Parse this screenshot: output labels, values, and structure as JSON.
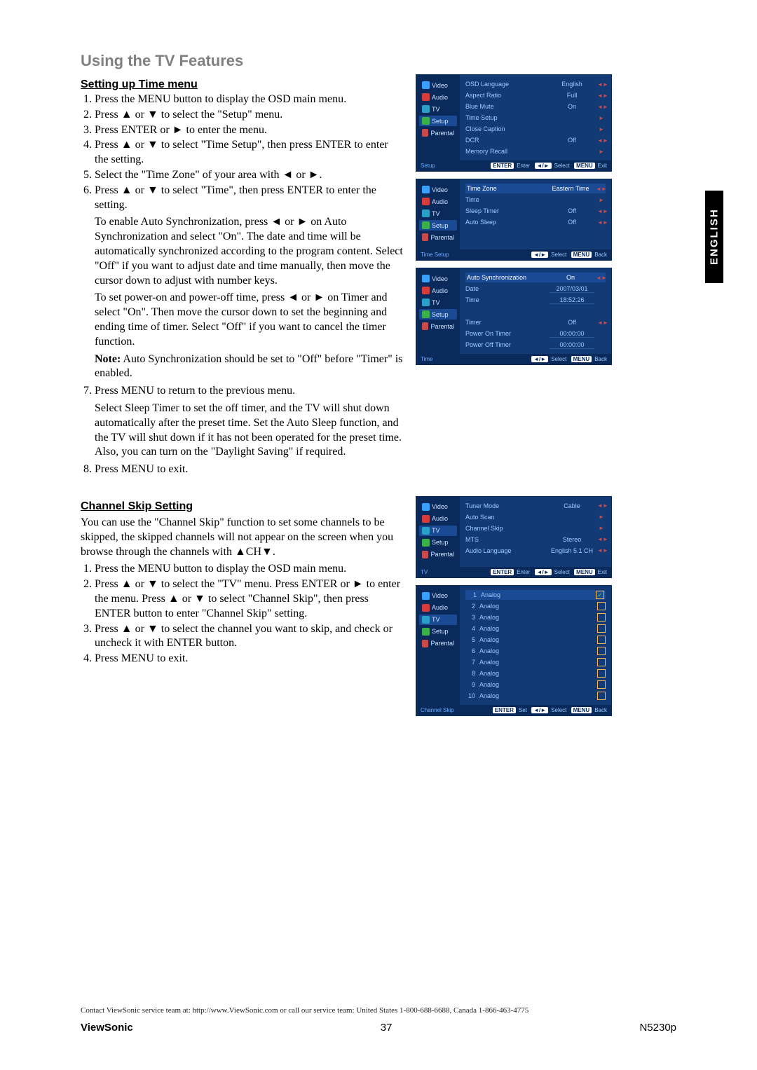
{
  "title": "Using the TV Features",
  "language_tab": "ENGLISH",
  "time_menu": {
    "heading": "Setting up Time menu",
    "steps": [
      "Press the MENU button to display the OSD main menu.",
      "Press ▲ or ▼ to select the \"Setup\" menu.",
      "Press ENTER or ► to enter the menu.",
      "Press ▲ or ▼ to select \"Time Setup\", then press ENTER to enter the setting.",
      "Select the \"Time Zone\" of your area with ◄ or ►.",
      "Press ▲ or ▼ to select \"Time\", then press ENTER to enter the setting.",
      "Press MENU to return to the previous menu.",
      "Press MENU to exit."
    ],
    "para1": "To enable Auto Synchronization, press ◄ or ► on Auto Synchronization and select \"On\". The date and time will be automatically synchronized according to the program content. Select \"Off\" if you want to adjust date and time manually, then move the cursor down to adjust with number keys.",
    "para2": "To set power-on and power-off time, press ◄ or ► on Timer and select \"On\". Then move the cursor down to set the beginning and ending time of timer. Select \"Off\" if you want to cancel the timer function.",
    "note": "Note: Auto Synchronization should be set to \"Off\" before \"Timer\" is enabled.",
    "para3": "Select Sleep Timer to set the off timer, and the TV will shut down automatically after the preset time. Set the Auto Sleep function, and the TV will shut down if it has not been operated for the preset time. Also, you can turn on the \"Daylight Saving\" if required."
  },
  "channel_skip": {
    "heading": "Channel Skip Setting",
    "intro": "You can use the \"Channel Skip\" function to set some channels to be skipped, the skipped channels will not appear on the screen when you browse through the channels with ▲CH▼.",
    "steps": [
      "Press the MENU button to display the OSD main menu.",
      "Press ▲ or ▼ to select the \"TV\" menu. Press ENTER or ► to enter the menu. Press ▲ or ▼ to select \"Channel Skip\", then press ENTER button to enter \"Channel Skip\" setting.",
      "Press ▲ or ▼ to select the channel you want to skip, and check or uncheck it with ENTER button.",
      "Press MENU to exit."
    ]
  },
  "osd_sidebar": [
    "Video",
    "Audio",
    "TV",
    "Setup",
    "Parental"
  ],
  "osd_hints": {
    "enter_label": "ENTER",
    "enter_hint": "Enter",
    "set_hint": "Set",
    "arrows": "◄/►",
    "select_hint": "Select",
    "menu_label": "MENU",
    "exit_hint": "Exit",
    "back_hint": "Back"
  },
  "osd1": {
    "title": "Setup",
    "active": "Setup",
    "rows": [
      {
        "lbl": "OSD Language",
        "val": "English",
        "ind": "◄►"
      },
      {
        "lbl": "Aspect Ratio",
        "val": "Full",
        "ind": "◄►"
      },
      {
        "lbl": "Blue Mute",
        "val": "On",
        "ind": "◄►"
      },
      {
        "lbl": "Time Setup",
        "val": "",
        "ind": "►"
      },
      {
        "lbl": "Close Caption",
        "val": "",
        "ind": "►"
      },
      {
        "lbl": "DCR",
        "val": "Off",
        "ind": "◄►"
      },
      {
        "lbl": "Memory Recall",
        "val": "",
        "ind": "►"
      }
    ]
  },
  "osd2": {
    "title": "Time Setup",
    "active": "Setup",
    "rows": [
      {
        "lbl": "Time Zone",
        "val": "Eastern Time",
        "ind": "◄►",
        "hl": true
      },
      {
        "lbl": "Time",
        "val": "",
        "ind": "►"
      },
      {
        "lbl": "Sleep Timer",
        "val": "Off",
        "ind": "◄►"
      },
      {
        "lbl": "Auto Sleep",
        "val": "Off",
        "ind": "◄►"
      }
    ]
  },
  "osd3": {
    "title": "Time",
    "active": "Setup",
    "rows": [
      {
        "lbl": "Auto Synchronization",
        "val": "On",
        "ind": "◄►",
        "hl": true
      },
      {
        "lbl": "Date",
        "val": "2007/03/01",
        "underline": true
      },
      {
        "lbl": "Time",
        "val": "18:52:26",
        "underline": true
      },
      {
        "lbl": "",
        "val": ""
      },
      {
        "lbl": "Timer",
        "val": "Off",
        "ind": "◄►"
      },
      {
        "lbl": "Power On Timer",
        "val": "00:00:00",
        "underline": true
      },
      {
        "lbl": "Power Off Timer",
        "val": "00:00:00",
        "underline": true
      }
    ]
  },
  "osd4": {
    "title": "TV",
    "active": "TV",
    "rows": [
      {
        "lbl": "Tuner Mode",
        "val": "Cable",
        "ind": "◄►"
      },
      {
        "lbl": "Auto Scan",
        "val": "",
        "ind": "►"
      },
      {
        "lbl": "Channel Skip",
        "val": "",
        "ind": "►"
      },
      {
        "lbl": "MTS",
        "val": "Stereo",
        "ind": "◄►"
      },
      {
        "lbl": "Audio Language",
        "val": "English 5.1 CH",
        "ind": "◄►"
      }
    ]
  },
  "osd5": {
    "title": "Channel Skip",
    "active": "TV",
    "channels": [
      {
        "n": "1",
        "t": "Analog",
        "c": true,
        "hl": true
      },
      {
        "n": "2",
        "t": "Analog",
        "c": false
      },
      {
        "n": "3",
        "t": "Analog",
        "c": false
      },
      {
        "n": "4",
        "t": "Analog",
        "c": false
      },
      {
        "n": "5",
        "t": "Analog",
        "c": false
      },
      {
        "n": "6",
        "t": "Analog",
        "c": false
      },
      {
        "n": "7",
        "t": "Analog",
        "c": false
      },
      {
        "n": "8",
        "t": "Analog",
        "c": false
      },
      {
        "n": "9",
        "t": "Analog",
        "c": false
      },
      {
        "n": "10",
        "t": "Analog",
        "c": false
      }
    ]
  },
  "footer": {
    "contact": "Contact ViewSonic service team at: http://www.ViewSonic.com or call our service team: United States 1-800-688-6688, Canada 1-866-463-4775",
    "brand": "ViewSonic",
    "page": "37",
    "model": "N5230p"
  }
}
